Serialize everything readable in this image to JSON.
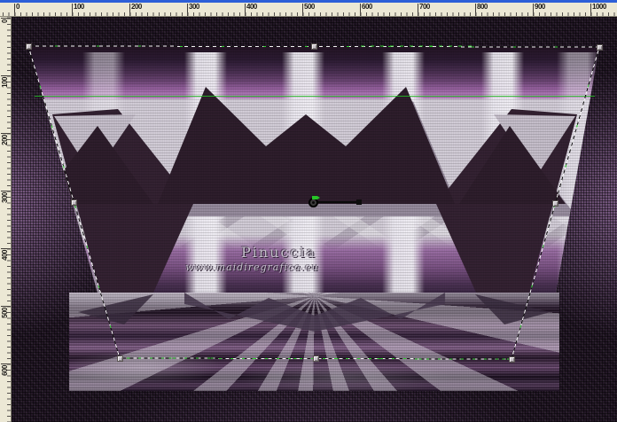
{
  "window": {
    "top_edge_color": "#2d5fd8"
  },
  "rulers": {
    "horizontal": {
      "labels": [
        "0",
        "100",
        "200",
        "300",
        "400",
        "500",
        "600",
        "700",
        "800",
        "900",
        "1000"
      ]
    },
    "vertical": {
      "labels": [
        "0",
        "100",
        "200",
        "300",
        "400",
        "500",
        "600"
      ]
    }
  },
  "canvas": {
    "watermark": {
      "title": "Pinuccia",
      "url": "www.maidiregrafica.eu"
    }
  },
  "transform_tool": {
    "handles": [
      "top-left",
      "top-center",
      "top-right",
      "middle-right",
      "bottom-right",
      "bottom-center",
      "bottom-left",
      "middle-left"
    ],
    "pivot": "rotation-pivot",
    "marquee_colors": {
      "dash_light": "#f2f2f2",
      "dash_dark": "#141414",
      "dash_accent": "#2fd02f"
    }
  },
  "palette": {
    "ruler_bg": "#ece8d5",
    "background_weave": "#231726",
    "background_glow": "#8b6796",
    "artwork_purple_band": "#a06cab",
    "artwork_light": "#d4ced9",
    "artwork_dark": "#2e1e2c",
    "floor_purple": "#8a6590"
  }
}
